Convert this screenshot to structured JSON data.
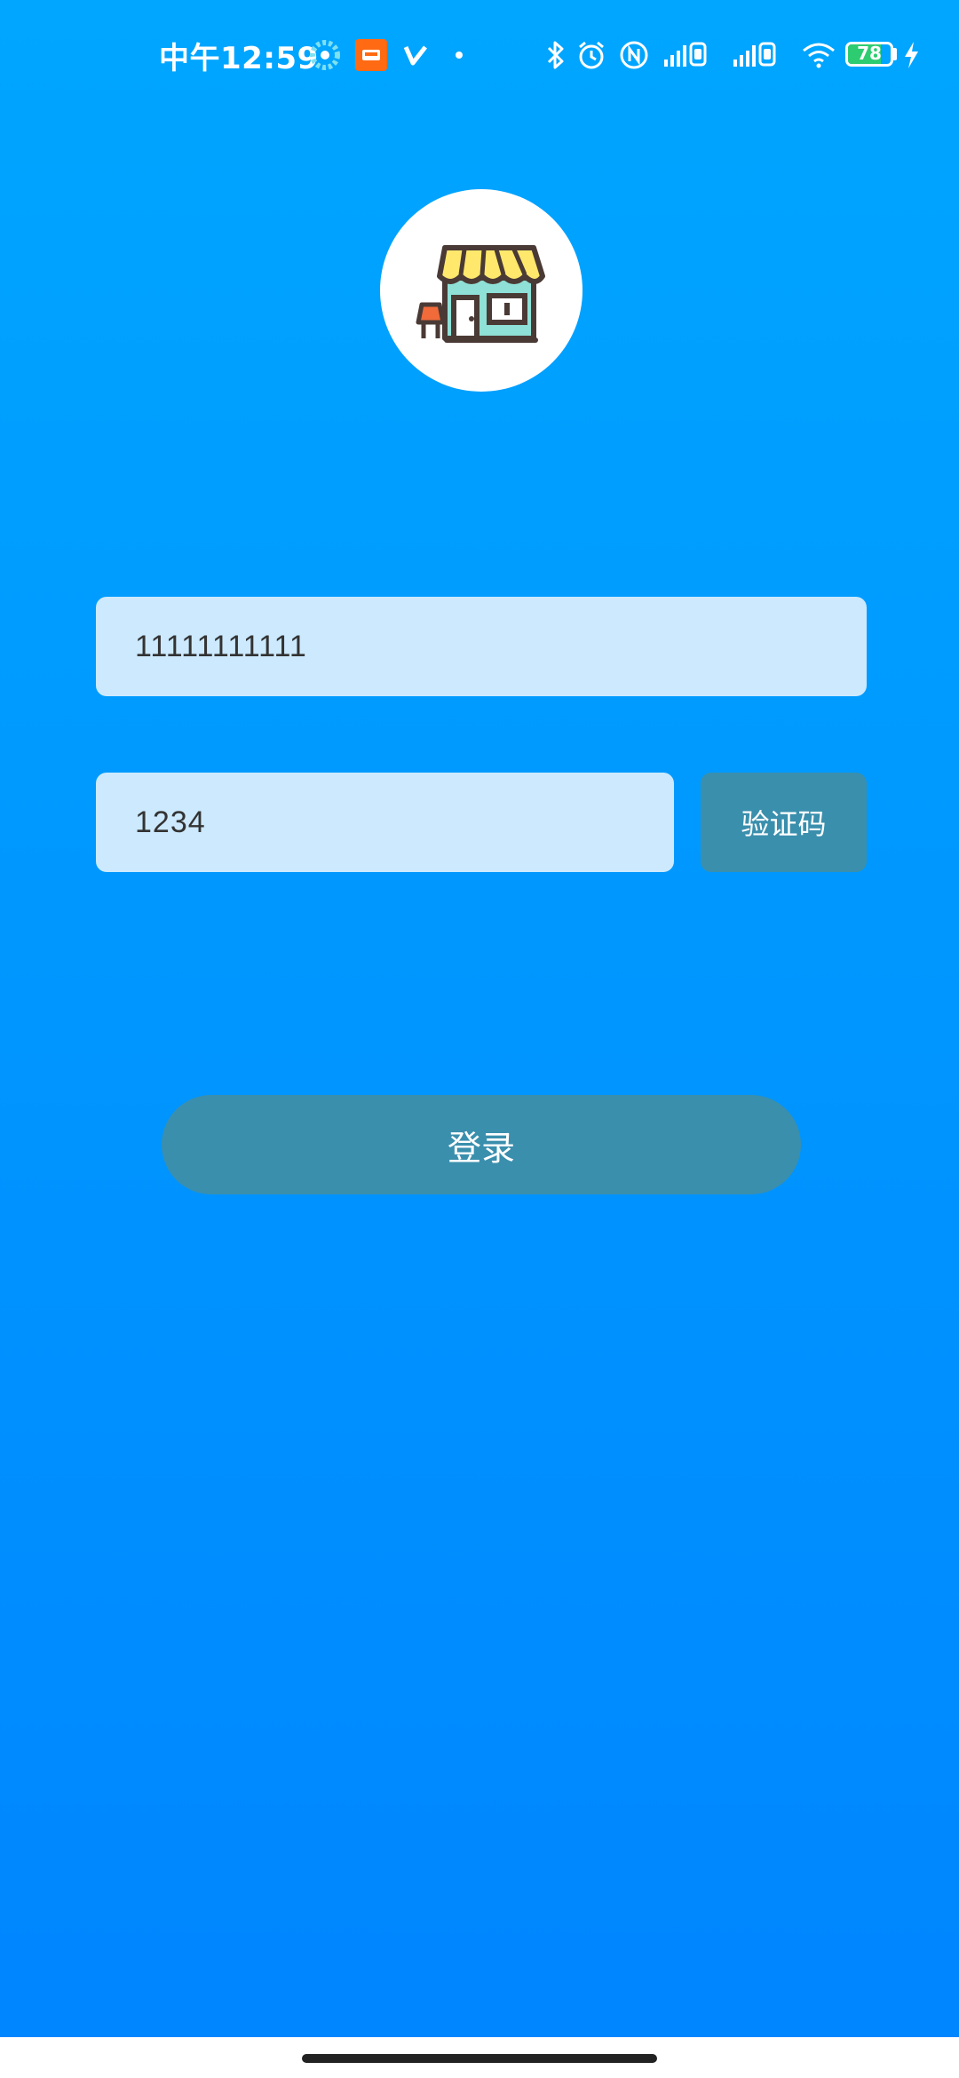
{
  "status_bar": {
    "time": "中午12:59",
    "battery_level": "78",
    "battery_fraction": 0.78,
    "icons": [
      "pinwheel-app-icon",
      "orange-app-icon",
      "check-mark-icon",
      "dot-icon",
      "bluetooth-icon",
      "alarm-icon",
      "nfc-icon",
      "signal-sim1-icon",
      "signal-sim2-icon",
      "wifi-icon",
      "battery-icon",
      "charging-bolt-icon"
    ]
  },
  "logo": {
    "icon": "storefront-icon"
  },
  "form": {
    "phone_value": "11111111111",
    "code_value": "1234",
    "code_button_label": "验证码",
    "login_button_label": "登录"
  },
  "colors": {
    "background_top": "#00a6ff",
    "background_bottom": "#0085ff",
    "input_bg": "#cce9fd",
    "button_bg": "#3a8fad",
    "battery_fill": "#2ecc71"
  }
}
